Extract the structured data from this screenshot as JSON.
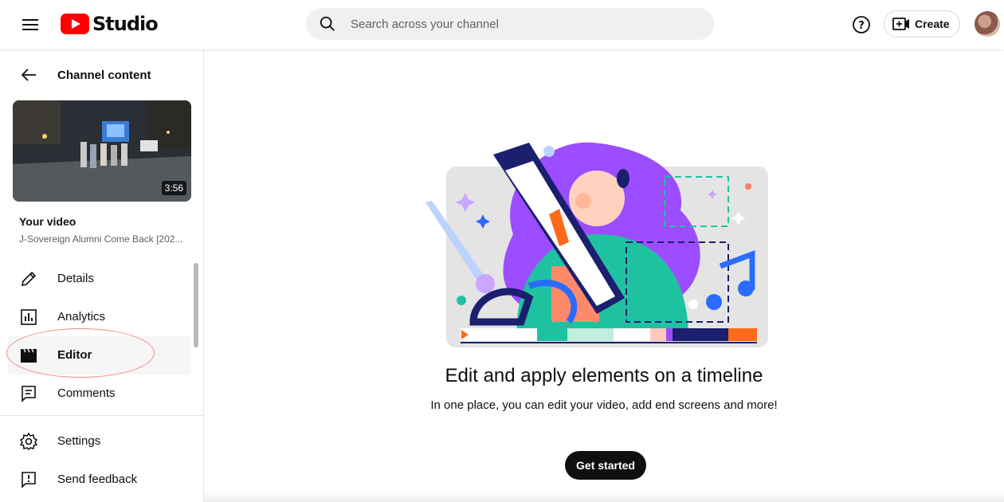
{
  "header": {
    "logo_text": "Studio",
    "search_placeholder": "Search across your channel",
    "create_label": "Create"
  },
  "sidebar": {
    "back_label": "Channel content",
    "video": {
      "duration": "3:56",
      "heading": "Your video",
      "title": "J-Sovereign Alumni Come Back [202..."
    },
    "nav": [
      {
        "label": "Details",
        "icon": "pencil-icon"
      },
      {
        "label": "Analytics",
        "icon": "analytics-icon"
      },
      {
        "label": "Editor",
        "icon": "clapperboard-icon",
        "active": true
      },
      {
        "label": "Comments",
        "icon": "comments-icon"
      }
    ],
    "footer": [
      {
        "label": "Settings",
        "icon": "gear-icon"
      },
      {
        "label": "Send feedback",
        "icon": "feedback-icon"
      }
    ]
  },
  "main": {
    "headline": "Edit and apply elements on a timeline",
    "subline": "In one place, you can edit your video, add end screens and more!",
    "cta_label": "Get started"
  },
  "colors": {
    "brand_red": "#ff0000",
    "annotation": "#e58f7c",
    "purple": "#9b4dff",
    "teal": "#1fc2a0",
    "orange": "#ff6a1a"
  }
}
